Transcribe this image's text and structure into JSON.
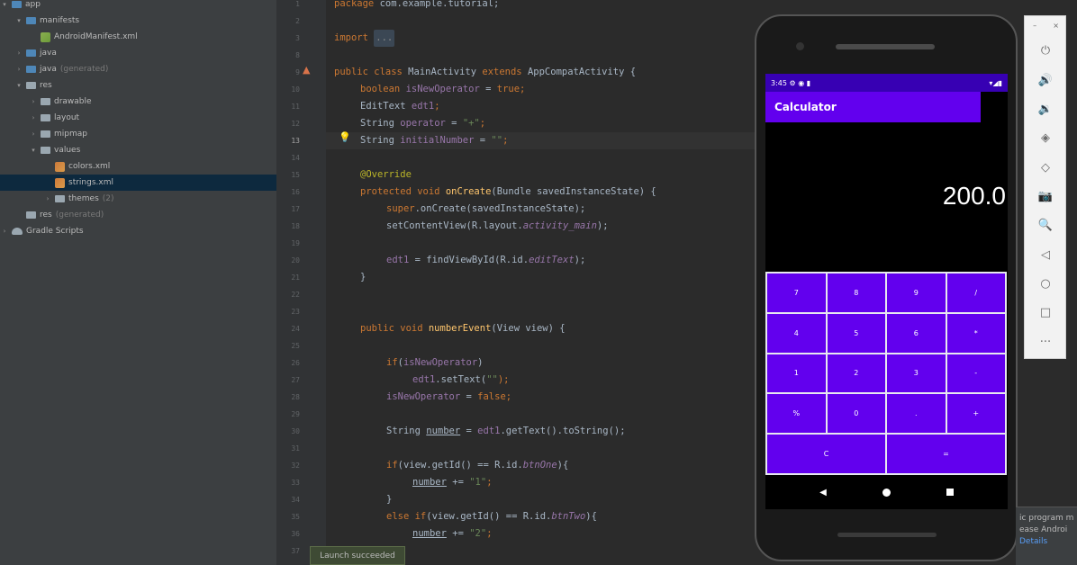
{
  "project_tree": [
    {
      "label": "app",
      "arrow": "▾",
      "icon": "folder-blue"
    },
    {
      "label": "manifests",
      "arrow": "▾",
      "icon": "folder-blue"
    },
    {
      "label": "AndroidManifest.xml",
      "arrow": "",
      "icon": "manifest"
    },
    {
      "label": "java",
      "arrow": "›",
      "icon": "folder-blue"
    },
    {
      "label": "java",
      "arrow": "›",
      "icon": "folder-blue",
      "suffix": "(generated)"
    },
    {
      "label": "res",
      "arrow": "▾",
      "icon": "folder-grey"
    },
    {
      "label": "drawable",
      "arrow": "›",
      "icon": "folder-grey"
    },
    {
      "label": "layout",
      "arrow": "›",
      "icon": "folder-grey"
    },
    {
      "label": "mipmap",
      "arrow": "›",
      "icon": "folder-grey"
    },
    {
      "label": "values",
      "arrow": "▾",
      "icon": "folder-grey"
    },
    {
      "label": "colors.xml",
      "arrow": "",
      "icon": "xml"
    },
    {
      "label": "strings.xml",
      "arrow": "",
      "icon": "xml",
      "selected": true
    },
    {
      "label": "themes",
      "arrow": "›",
      "icon": "folder-grey",
      "suffix": "(2)"
    },
    {
      "label": "res",
      "arrow": "",
      "icon": "folder-grey",
      "suffix": "(generated)"
    },
    {
      "label": "Gradle Scripts",
      "arrow": "›",
      "icon": "gradle"
    }
  ],
  "gutter": {
    "line_numbers": [
      "1",
      "2",
      "3",
      "8",
      "9",
      "10",
      "11",
      "12",
      "13",
      "14",
      "15",
      "16",
      "17",
      "18",
      "19",
      "20",
      "21",
      "22",
      "23",
      "24",
      "25",
      "26",
      "27",
      "28",
      "29",
      "30",
      "31",
      "32",
      "33",
      "34",
      "35",
      "36",
      "37"
    ],
    "current_line": "13",
    "bulb_glyph": "💡",
    "run_glyph": "▲"
  },
  "code": {
    "l1": {
      "kw": "package",
      "rest": " com.example.tutorial;"
    },
    "l3": {
      "kw": "import",
      "fold": "..."
    },
    "l9": {
      "kw1": "public class",
      "name": " MainActivity ",
      "kw2": "extends",
      "rest": " AppCompatActivity {"
    },
    "l10": {
      "kw": "boolean",
      "fld": " isNewOperator",
      "mid": " = ",
      "kw2": "true",
      "end": ";"
    },
    "l11": {
      "plain": "EditText ",
      "fld": "edt1",
      "end": ";"
    },
    "l12": {
      "plain": "String ",
      "fld": "operator",
      "mid": " = ",
      "str": "\"+\"",
      "end": ";"
    },
    "l13": {
      "plain": "String ",
      "fld": "initialNumber",
      "mid": " = ",
      "str": "\"\"",
      "end": ";"
    },
    "l15": {
      "ann": "@Override"
    },
    "l16": {
      "kw": "protected void ",
      "fn": "onCreate",
      "rest": "(Bundle savedInstanceState) {"
    },
    "l17": {
      "kw": "super",
      "rest": ".onCreate(savedInstanceState);"
    },
    "l18": {
      "plain": "setContentView(R.layout.",
      "fld": "activity_main",
      "end": ");"
    },
    "l20": {
      "fld": "edt1",
      "plain": " = findViewById(R.id.",
      "fld2": "editText",
      "end": ");"
    },
    "l21": {
      "plain": "}"
    },
    "l24": {
      "kw": "public void ",
      "fn": "numberEvent",
      "rest": "(View view) {"
    },
    "l26": {
      "kw": "if",
      "plain": "(",
      "fld": "isNewOperator",
      "end": ")"
    },
    "l27": {
      "fld": "edt1",
      "plain": ".setText(",
      "str": "\"\"",
      "end": ");"
    },
    "l28": {
      "fld": "isNewOperator",
      "mid": " = ",
      "kw": "false",
      "end": ";"
    },
    "l30": {
      "plain": "String ",
      "ul": "number",
      "rest": " = ",
      "fld": "edt1",
      "end": ".getText().toString();"
    },
    "l32": {
      "kw": "if",
      "plain": "(view.getId() == R.id.",
      "fld": "btnOne",
      "end": "){"
    },
    "l33": {
      "ul": "number",
      "mid": " += ",
      "str": "\"1\"",
      "end": ";"
    },
    "l34": {
      "plain": "}"
    },
    "l35": {
      "kw": "else if",
      "plain": "(view.getId() == R.id.",
      "fld": "btnTwo",
      "end": "){"
    },
    "l36": {
      "ul": "number",
      "mid": " += ",
      "str": "\"2\"",
      "end": ";"
    }
  },
  "toast": "Launch succeeded",
  "emulator": {
    "status_time": "3:45",
    "status_icons": "⚙ ◉ ▮",
    "status_right": "▾◢▮",
    "app_title": "Calculator",
    "display_value": "200.0",
    "keys": [
      "7",
      "8",
      "9",
      "/",
      "4",
      "5",
      "6",
      "*",
      "1",
      "2",
      "3",
      "-",
      "%",
      "0",
      ".",
      "+",
      "C",
      "="
    ],
    "nav": {
      "back": "◀"
    }
  },
  "emulator_toolbar": {
    "top": [
      "–",
      "×"
    ],
    "buttons": [
      "⏻",
      "🔊",
      "🔉",
      "◈",
      "◇",
      "📷",
      "🔍",
      "◁",
      "○",
      "□",
      "···"
    ]
  },
  "notification": {
    "line1": "ic program m",
    "line2": "ease Androi",
    "link": "Details"
  }
}
